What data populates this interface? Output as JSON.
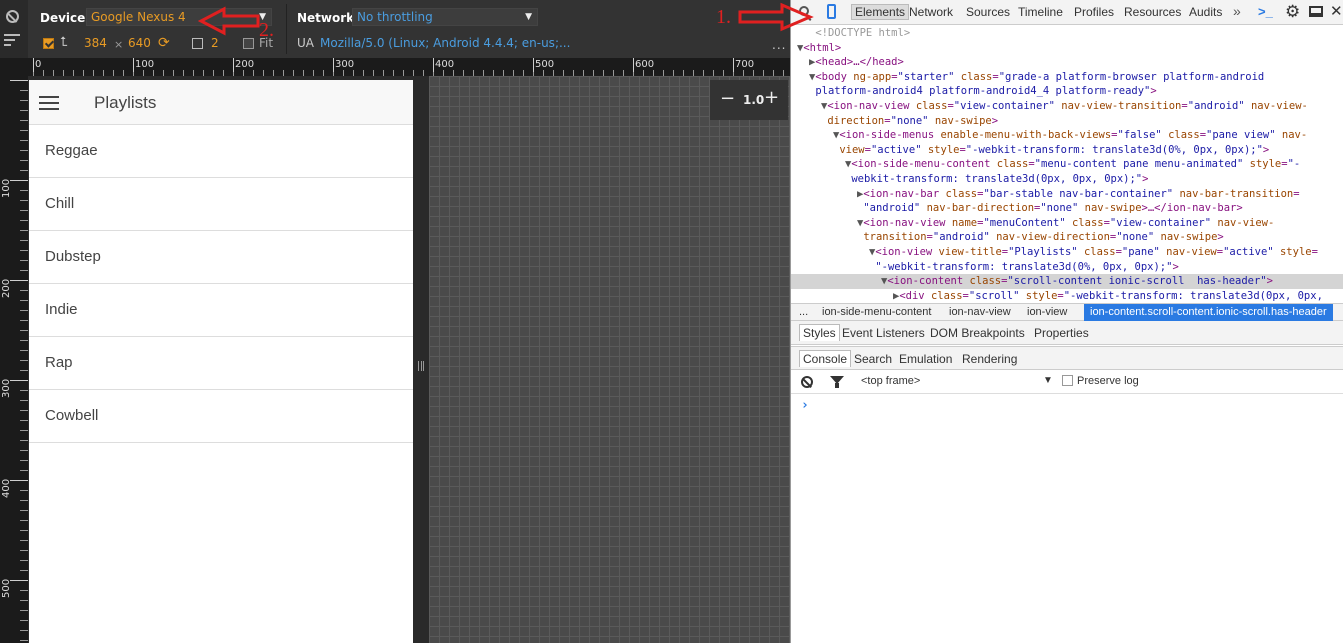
{
  "emulation": {
    "device_label": "Device",
    "device_value": "Google Nexus 4",
    "network_label": "Network",
    "network_value": "No throttling",
    "width": "384",
    "times": "×",
    "height": "640",
    "dpr": "2",
    "fit_label": "Fit",
    "ua_label": "UA",
    "ua_value": "Mozilla/5.0 (Linux; Android 4.4.4; en-us;...",
    "more": "...",
    "accent_color": "#e89b24",
    "link_color": "#4a9de0"
  },
  "rulers": {
    "horizontal": [
      "0",
      "100",
      "200",
      "300",
      "400",
      "500",
      "600",
      "700"
    ],
    "vertical": [
      "100",
      "200",
      "300",
      "400",
      "500"
    ]
  },
  "app": {
    "title": "Playlists",
    "items": [
      "Reggae",
      "Chill",
      "Dubstep",
      "Indie",
      "Rap",
      "Cowbell"
    ]
  },
  "zoom": {
    "minus": "−",
    "value": "1.0",
    "plus": "+"
  },
  "devtools": {
    "tabs": [
      "Elements",
      "Network",
      "Sources",
      "Timeline",
      "Profiles",
      "Resources",
      "Audits"
    ],
    "active_tab": "Elements",
    "more_tabs": "»",
    "console_drawer": ">_",
    "dom": [
      {
        "indent": 1,
        "tw": "",
        "html": "<span class='dom-grey'>&lt;!DOCTYPE html&gt;</span>"
      },
      {
        "indent": 0,
        "tw": "▼",
        "html": "&lt;html&gt;"
      },
      {
        "indent": 1,
        "tw": "▶",
        "html": "&lt;head&gt;…&lt;/head&gt;"
      },
      {
        "indent": 1,
        "tw": "▼",
        "html": "&lt;body <span class='attr-n'>ng-app</span>=<span class='attr-v'>\"starter\"</span> <span class='attr-n'>class</span>=<span class='attr-v'>\"grade-a platform-browser platform-android</span>"
      },
      {
        "indent": 1,
        "tw": "",
        "html": "<span class='attr-v'>platform-android4 platform-android4_4 platform-ready\"</span>&gt;"
      },
      {
        "indent": 2,
        "tw": "▼",
        "html": "&lt;ion-nav-view <span class='attr-n'>class</span>=<span class='attr-v'>\"view-container\"</span> <span class='attr-n'>nav-view-transition</span>=<span class='attr-v'>\"android\"</span> <span class='attr-n'>nav-view-</span>"
      },
      {
        "indent": 2,
        "tw": "",
        "html": "<span class='attr-n'>direction</span>=<span class='attr-v'>\"none\"</span> <span class='attr-n'>nav-swipe</span>&gt;"
      },
      {
        "indent": 3,
        "tw": "▼",
        "html": "&lt;ion-side-menus <span class='attr-n'>enable-menu-with-back-views</span>=<span class='attr-v'>\"false\"</span> <span class='attr-n'>class</span>=<span class='attr-v'>\"pane view\"</span> <span class='attr-n'>nav-</span>"
      },
      {
        "indent": 3,
        "tw": "",
        "html": "<span class='attr-n'>view</span>=<span class='attr-v'>\"active\"</span> <span class='attr-n'>style</span>=<span class='attr-v'>\"-webkit-transform: translate3d(0%, 0px, 0px);\"</span>&gt;"
      },
      {
        "indent": 4,
        "tw": "▼",
        "html": "&lt;ion-side-menu-content <span class='attr-n'>class</span>=<span class='attr-v'>\"menu-content pane menu-animated\"</span> <span class='attr-n'>style</span>=<span class='attr-v'>\"-</span>"
      },
      {
        "indent": 4,
        "tw": "",
        "html": "<span class='attr-v'>webkit-transform: translate3d(0px, 0px, 0px);\"</span>&gt;"
      },
      {
        "indent": 5,
        "tw": "▶",
        "html": "&lt;ion-nav-bar <span class='attr-n'>class</span>=<span class='attr-v'>\"bar-stable nav-bar-container\"</span> <span class='attr-n'>nav-bar-transition</span>="
      },
      {
        "indent": 5,
        "tw": "",
        "html": "<span class='attr-v'>\"android\"</span> <span class='attr-n'>nav-bar-direction</span>=<span class='attr-v'>\"none\"</span> <span class='attr-n'>nav-swipe</span>&gt;…&lt;/ion-nav-bar&gt;"
      },
      {
        "indent": 5,
        "tw": "▼",
        "html": "&lt;ion-nav-view <span class='attr-n'>name</span>=<span class='attr-v'>\"menuContent\"</span> <span class='attr-n'>class</span>=<span class='attr-v'>\"view-container\"</span> <span class='attr-n'>nav-view-</span>"
      },
      {
        "indent": 5,
        "tw": "",
        "html": "<span class='attr-n'>transition</span>=<span class='attr-v'>\"android\"</span> <span class='attr-n'>nav-view-direction</span>=<span class='attr-v'>\"none\"</span> <span class='attr-n'>nav-swipe</span>&gt;"
      },
      {
        "indent": 6,
        "tw": "▼",
        "html": "&lt;ion-view <span class='attr-n'>view-title</span>=<span class='attr-v'>\"Playlists\"</span> <span class='attr-n'>class</span>=<span class='attr-v'>\"pane\"</span> <span class='attr-n'>nav-view</span>=<span class='attr-v'>\"active\"</span> <span class='attr-n'>style</span>="
      },
      {
        "indent": 6,
        "tw": "",
        "html": "<span class='attr-v'>\"-webkit-transform: translate3d(0%, 0px, 0px);\"</span>&gt;"
      },
      {
        "indent": 7,
        "tw": "▼",
        "html": "&lt;ion-content <span class='attr-n'>class</span>=<span class='attr-v'>\"scroll-content ionic-scroll  has-header\"</span>&gt;",
        "selected": true
      },
      {
        "indent": 8,
        "tw": "▶",
        "html": "&lt;div <span class='attr-n'>class</span>=<span class='attr-v'>\"scroll\"</span> <span class='attr-n'>style</span>=<span class='attr-v'>\"-webkit-transform: translate3d(0px, 0px,</span>"
      }
    ],
    "breadcrumbs": [
      "...",
      "ion-side-menu-content",
      "ion-nav-view",
      "ion-view",
      "ion-content.scroll-content.ionic-scroll.has-header"
    ],
    "subtabs": [
      "Styles",
      "Event Listeners",
      "DOM Breakpoints",
      "Properties"
    ],
    "drawer_tabs": [
      "Console",
      "Search",
      "Emulation",
      "Rendering"
    ],
    "frame": "<top frame>",
    "preserve_log": "Preserve log",
    "prompt": "›"
  },
  "annotations": {
    "one": "1.",
    "two": "2.",
    "color": "#e02020"
  }
}
